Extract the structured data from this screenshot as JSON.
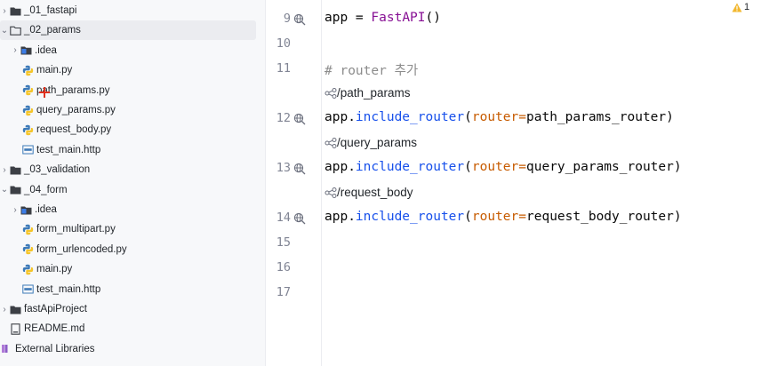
{
  "tree": [
    {
      "label": "_01_fastapi",
      "type": "folder",
      "depth": 0,
      "expanded": false
    },
    {
      "label": "_02_params",
      "type": "folder-open",
      "depth": 0,
      "expanded": true,
      "selected": true
    },
    {
      "label": ".idea",
      "type": "idea",
      "depth": 1,
      "expanded": false
    },
    {
      "label": "main.py",
      "type": "python",
      "depth": 2
    },
    {
      "label": "path_params.py",
      "type": "python",
      "depth": 2
    },
    {
      "label": "query_params.py",
      "type": "python",
      "depth": 2
    },
    {
      "label": "request_body.py",
      "type": "python",
      "depth": 2
    },
    {
      "label": "test_main.http",
      "type": "http",
      "depth": 2
    },
    {
      "label": "_03_validation",
      "type": "folder",
      "depth": 0,
      "expanded": false
    },
    {
      "label": "_04_form",
      "type": "folder",
      "depth": 0,
      "expanded": true
    },
    {
      "label": ".idea",
      "type": "idea",
      "depth": 1,
      "expanded": false
    },
    {
      "label": "form_multipart.py",
      "type": "python",
      "depth": 2
    },
    {
      "label": "form_urlencoded.py",
      "type": "python",
      "depth": 2
    },
    {
      "label": "main.py",
      "type": "python",
      "depth": 2
    },
    {
      "label": "test_main.http",
      "type": "http",
      "depth": 2
    },
    {
      "label": "fastApiProject",
      "type": "folder",
      "depth": 0,
      "expanded": false
    },
    {
      "label": "README.md",
      "type": "markdown",
      "depth": 0
    },
    {
      "label": "External Libraries",
      "type": "libraries",
      "depth": -1
    }
  ],
  "editor": {
    "line_numbers": [
      "9",
      "10",
      "11",
      "12",
      "13",
      "14",
      "15",
      "16",
      "17"
    ],
    "line9": {
      "lhs": "app",
      "eq": " = ",
      "cls": "FastAPI",
      "paren": "()"
    },
    "line11": {
      "comment": "# router 추가"
    },
    "hint1": "/path_params",
    "line12": {
      "obj": "app.",
      "fn": "include_router",
      "open": "(",
      "param": "router",
      "eq": "=",
      "arg": "path_params_router",
      "close": ")"
    },
    "hint2": "/query_params",
    "line13": {
      "obj": "app.",
      "fn": "include_router",
      "open": "(",
      "param": "router",
      "eq": "=",
      "arg": "query_params_router",
      "close": ")"
    },
    "hint3": "/request_body",
    "line14": {
      "obj": "app.",
      "fn": "include_router",
      "open": "(",
      "param": "router",
      "eq": "=",
      "arg": "request_body_router",
      "close": ")"
    }
  },
  "warnings": {
    "count": "1",
    "icon": "warning-triangle-icon",
    "color": "#f2b72e"
  },
  "colors": {
    "python_blue": "#3d7ab8",
    "python_yellow": "#f5c52a",
    "folder": "#3c3f45",
    "idea": "#3c7ee8",
    "cursor": "#e0311f"
  }
}
